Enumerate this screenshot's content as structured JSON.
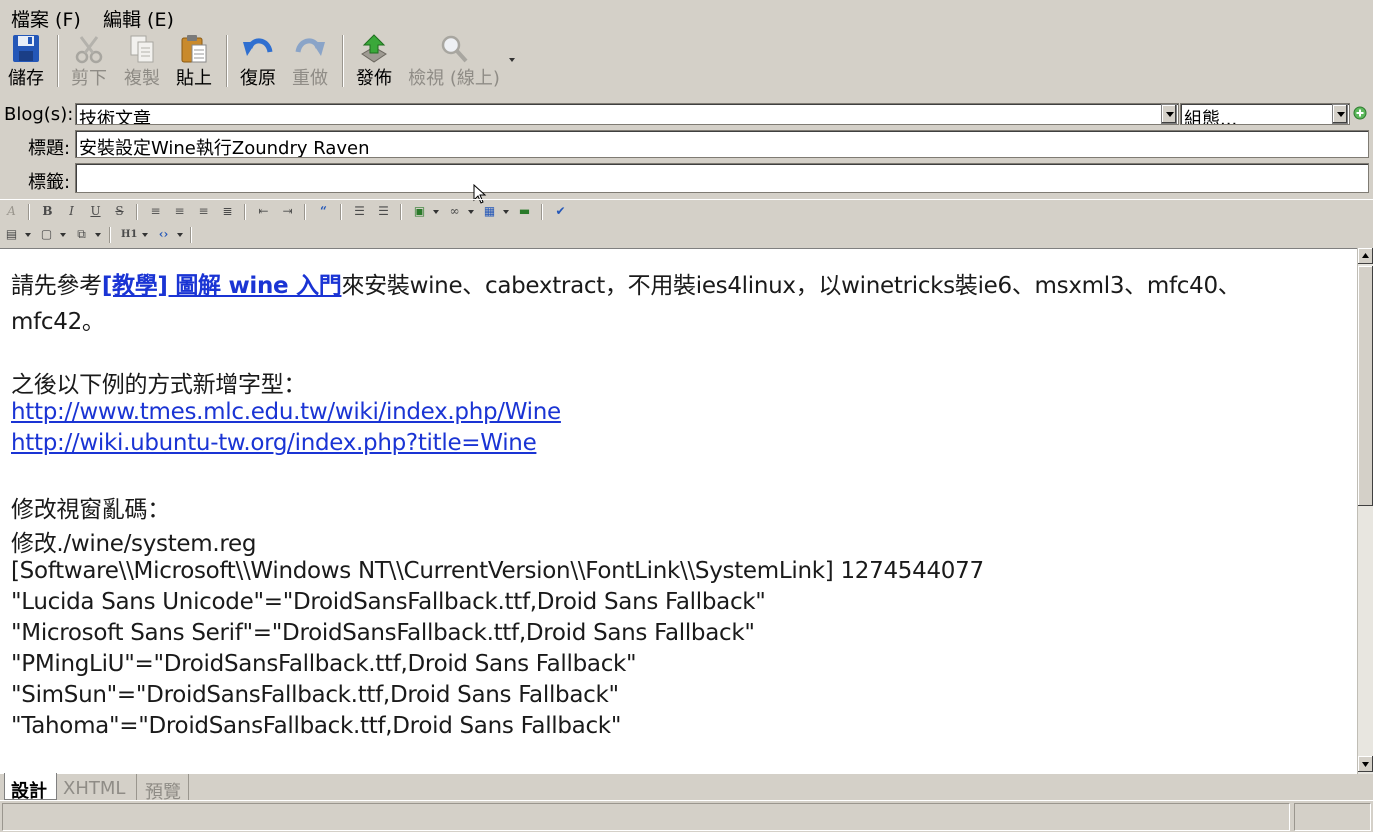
{
  "menu": {
    "file": "檔案 (F)",
    "edit": "編輯 (E)"
  },
  "toolbar": {
    "save": "儲存",
    "cut": "剪下",
    "copy": "複製",
    "paste": "貼上",
    "undo": "復原",
    "redo": "重做",
    "publish": "發佈",
    "view": "檢視 (線上)"
  },
  "form": {
    "blog_label": "Blog(s):",
    "blog_value": "技術文章",
    "config_value": "組態...",
    "title_label": "標題:",
    "title_value": "安裝設定Wine執行Zoundry Raven",
    "tags_label": "標籤:",
    "tags_value": ""
  },
  "format_bar": {
    "heading_label": "H1"
  },
  "content": {
    "p1_prefix": "請先參考",
    "p1_link": "[教學] 圖解 wine 入門",
    "p1_suffix": "來安裝wine、cabextract，不用裝ies4linux，以winetricks裝ie6、msxml3、mfc40、",
    "p1_cont": "mfc42。",
    "p2": "之後以下例的方式新增字型：",
    "link1": "http://www.tmes.mlc.edu.tw/wiki/index.php/Wine",
    "link2": "http://wiki.ubuntu-tw.org/index.php?title=Wine",
    "p3": "修改視窗亂碼：",
    "p4": "修改./wine/system.reg",
    "reg_key": "[Software\\\\Microsoft\\\\Windows NT\\\\CurrentVersion\\\\FontLink\\\\SystemLink] 1274544077",
    "reg_lines": [
      "\"Lucida Sans Unicode\"=\"DroidSansFallback.ttf,Droid Sans Fallback\"",
      "\"Microsoft Sans Serif\"=\"DroidSansFallback.ttf,Droid Sans Fallback\"",
      "\"PMingLiU\"=\"DroidSansFallback.ttf,Droid Sans Fallback\"",
      "\"SimSun\"=\"DroidSansFallback.ttf,Droid Sans Fallback\"",
      "\"Tahoma\"=\"DroidSansFallback.ttf,Droid Sans Fallback\""
    ]
  },
  "tabs": [
    "設計",
    "XHTML",
    "預覽"
  ],
  "icons": {
    "save": "floppy-disk-icon",
    "cut": "scissors-icon",
    "copy": "copy-icon",
    "paste": "clipboard-icon",
    "undo": "undo-arrow-icon",
    "redo": "redo-arrow-icon",
    "publish": "upload-arrow-icon",
    "view": "magnifier-icon",
    "add": "plus-circle-icon"
  },
  "colors": {
    "link": "#1a34d4",
    "chrome": "#d4d0c8",
    "disabled_text": "#8f8c86"
  }
}
